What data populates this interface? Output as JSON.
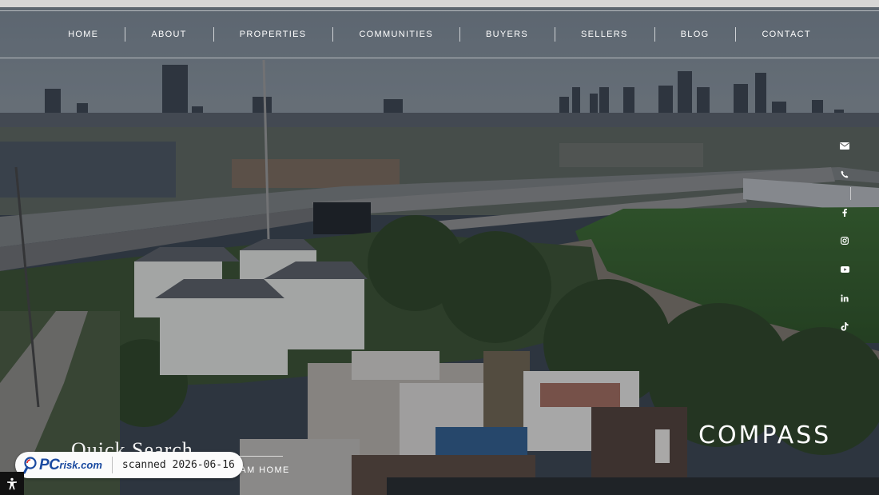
{
  "nav": {
    "items": [
      {
        "label": "HOME"
      },
      {
        "label": "ABOUT"
      },
      {
        "label": "PROPERTIES"
      },
      {
        "label": "COMMUNITIES"
      },
      {
        "label": "BUYERS"
      },
      {
        "label": "SELLERS"
      },
      {
        "label": "BLOG"
      },
      {
        "label": "CONTACT"
      }
    ]
  },
  "social": [
    "mail-icon",
    "phone-icon",
    "facebook-icon",
    "instagram-icon",
    "youtube-icon",
    "linkedin-icon",
    "tiktok-icon"
  ],
  "brand": {
    "logo_text": "COMPASS"
  },
  "quick_search": {
    "title": "Quick Search",
    "link": "CLICK HERE TO FIND YOUR DREAM HOME"
  },
  "badge": {
    "brand": "PC",
    "brand_rest": "risk",
    "domain": ".com",
    "scan_text": "scanned 2026-06-16"
  },
  "colors": {
    "overlay": "#0a0e16",
    "nav_text": "#ffffff",
    "badge_blue": "#1a4aa0"
  }
}
